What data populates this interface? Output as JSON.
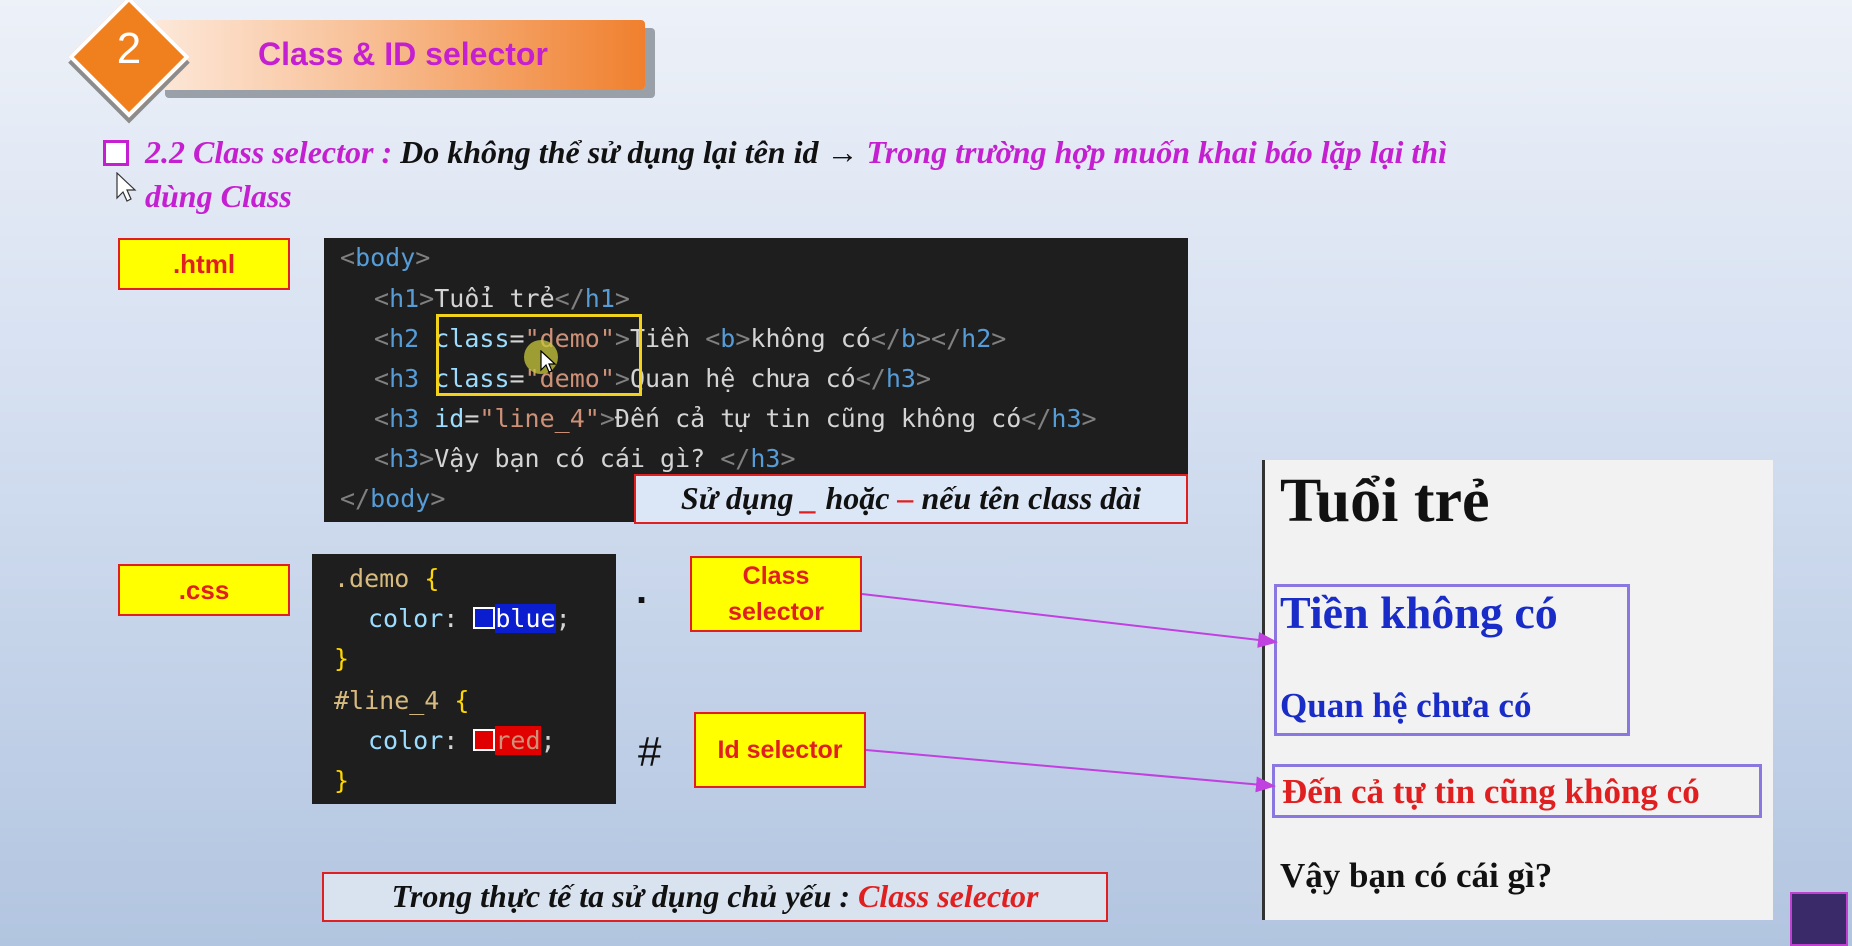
{
  "header": {
    "section_number": "2",
    "title": "Class & ID selector"
  },
  "subtitle": {
    "number": "2.2",
    "topic": "Class selector :",
    "plain": "Do không thể sử dụng lại tên id",
    "arrow": "→",
    "highlight_line1": "Trong trường hợp muốn khai báo lặp lại thì",
    "highlight_line2": "dùng Class"
  },
  "labels": {
    "html": ".html",
    "css": ".css",
    "class_selector_line1": "Class",
    "class_selector_line2": "selector",
    "id_selector": "Id selector",
    "dot": ".",
    "hash": "#"
  },
  "html_code": {
    "body_open": "body",
    "body_close": "body",
    "h1": "h1",
    "h2": "h2",
    "h3": "h3",
    "b": "b",
    "class_attr": "class",
    "id_attr": "id",
    "class_value": "\"demo\"",
    "id_value": "\"line_4\"",
    "line1_text": "Tuổi trẻ",
    "line2_text_a": "Tiền ",
    "line2_text_b": "không có",
    "line3_text": "Quan hệ chưa có",
    "line4_text": "Đến cả tự tin cũng không có",
    "line5_text": "Vậy bạn có cái gì? "
  },
  "note": {
    "part1": "Sử dụng ",
    "underscore": "_",
    "part2": " hoặc ",
    "dash": "–",
    "part3": " nếu tên class dài"
  },
  "css_code": {
    "selector1": ".demo",
    "selector2": "#line_4",
    "property": "color",
    "value1": "blue",
    "value2": "red"
  },
  "conclusion": {
    "text": "Trong thực tế ta sử dụng chủ yếu : ",
    "highlight": "Class selector"
  },
  "preview": {
    "h1": "Tuổi trẻ",
    "h2": "Tiền không có",
    "h3_demo": "Quan hệ chưa có",
    "h3_id": "Đến cả tự tin cũng không có",
    "h3_plain": "Vậy bạn có cái gì?"
  },
  "colors": {
    "magenta": "#c41fd0",
    "accent_orange": "#f07f1e",
    "label_yellow": "#ffff00",
    "red": "#e02020",
    "preview_blue": "#1a2cc8",
    "highlight_box": "#f2d21b",
    "arrow_purple": "#c040e0"
  },
  "icons": {
    "bullet": "checkbox-square-icon",
    "cursor": "mouse-pointer-icon",
    "avatar": "channel-avatar-icon"
  }
}
